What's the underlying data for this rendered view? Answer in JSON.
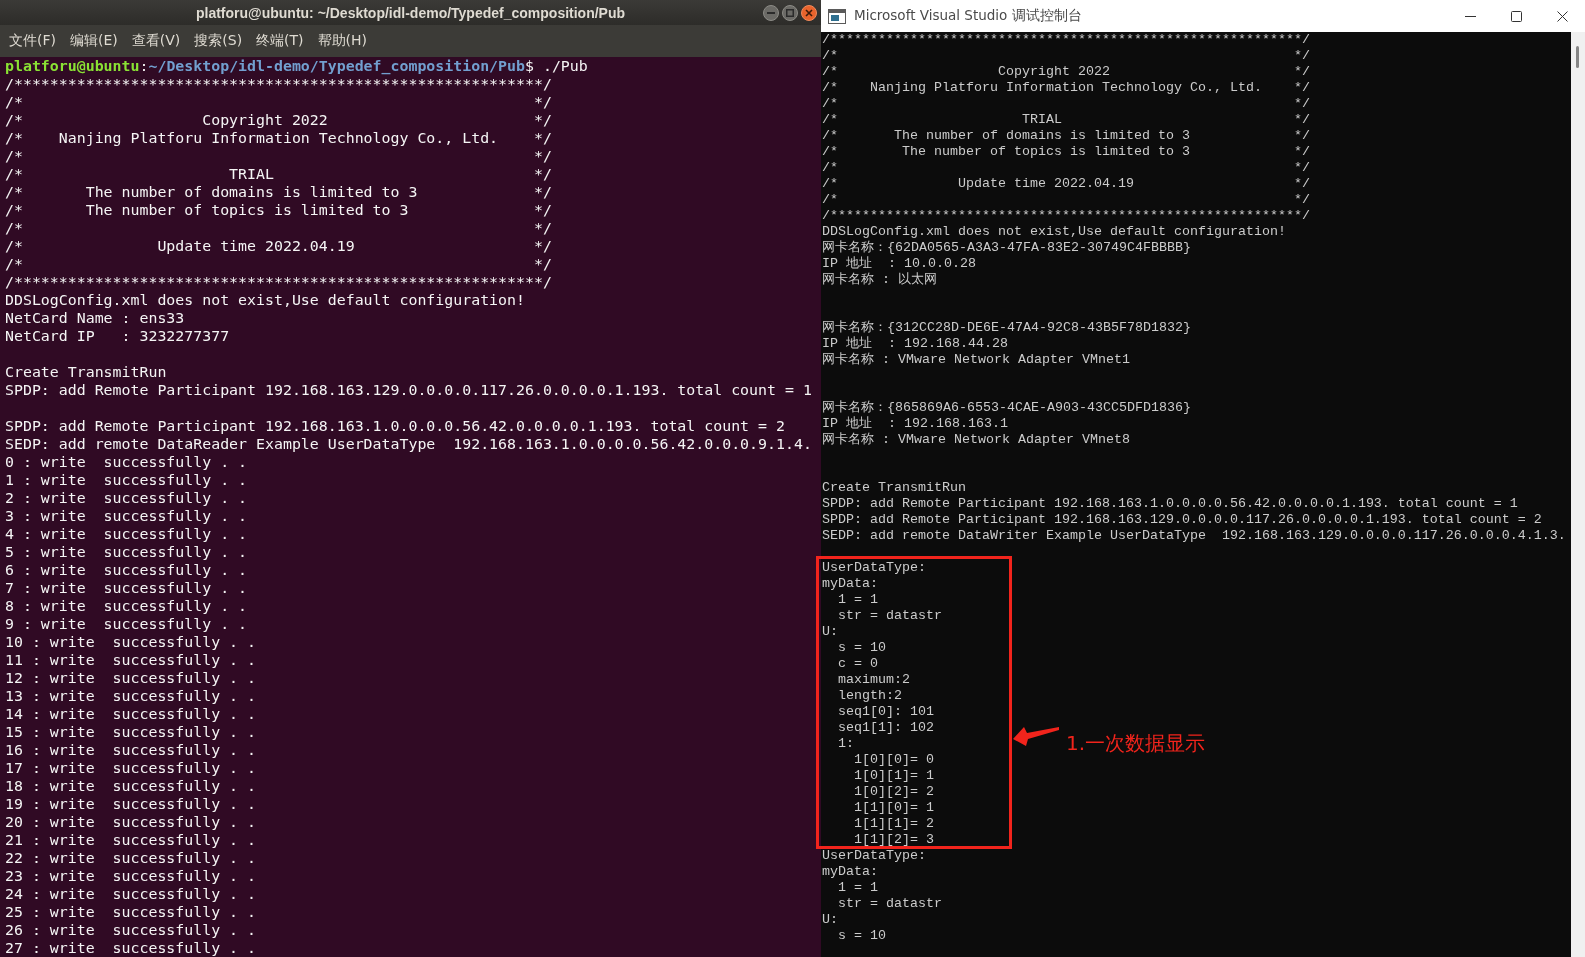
{
  "terminal_window": {
    "title": "platforu@ubuntu: ~/Desktop/idl-demo/Typedef_composition/Pub",
    "menu": [
      "文件(F)",
      "编辑(E)",
      "查看(V)",
      "搜索(S)",
      "终端(T)",
      "帮助(H)"
    ],
    "prompt": {
      "user_host": "platforu@ubuntu",
      "separator": ":",
      "path": "~/Desktop/idl-demo/Typedef_composition/Pub",
      "command": "$ ./Pub"
    },
    "lines": [
      {
        "kind": "text",
        "text": "/***********************************************************/"
      },
      {
        "kind": "text",
        "text": "/*                                                         */"
      },
      {
        "kind": "text",
        "text": "/*                    Copyright 2022                       */"
      },
      {
        "kind": "text",
        "text": "/*    Nanjing Platforu Information Technology Co., Ltd.    */"
      },
      {
        "kind": "text",
        "text": "/*                                                         */"
      },
      {
        "kind": "text",
        "text": "/*                       TRIAL                             */"
      },
      {
        "kind": "text",
        "text": "/*       The number of domains is limited to 3             */"
      },
      {
        "kind": "text",
        "text": "/*       The number of topics is limited to 3              */"
      },
      {
        "kind": "text",
        "text": "/*                                                         */"
      },
      {
        "kind": "text",
        "text": "/*               Update time 2022.04.19                    */"
      },
      {
        "kind": "text",
        "text": "/*                                                         */"
      },
      {
        "kind": "text",
        "text": "/***********************************************************/"
      },
      {
        "kind": "text",
        "text": "DDSLogConfig.xml does not exist,Use default configuration!"
      },
      {
        "kind": "text",
        "text": "NetCard Name : ens33"
      },
      {
        "kind": "text",
        "text": "NetCard IP   : 3232277377"
      },
      {
        "kind": "blank"
      },
      {
        "kind": "text",
        "text": "Create TransmitRun"
      },
      {
        "kind": "text",
        "text": "SPDP: add Remote Participant 192.168.163.129.0.0.0.0.117.26.0.0.0.0.1.193. total count = 1"
      },
      {
        "kind": "blank"
      },
      {
        "kind": "text",
        "text": "SPDP: add Remote Participant 192.168.163.1.0.0.0.0.56.42.0.0.0.0.1.193. total count = 2"
      },
      {
        "kind": "text",
        "text": "SEDP: add remote DataReader Example UserDataType  192.168.163.1.0.0.0.0.56.42.0.0.0.9.1.4."
      },
      {
        "kind": "text",
        "text": "0 : write  successfully . ."
      },
      {
        "kind": "text",
        "text": "1 : write  successfully . ."
      },
      {
        "kind": "text",
        "text": "2 : write  successfully . ."
      },
      {
        "kind": "text",
        "text": "3 : write  successfully . ."
      },
      {
        "kind": "text",
        "text": "4 : write  successfully . ."
      },
      {
        "kind": "text",
        "text": "5 : write  successfully . ."
      },
      {
        "kind": "text",
        "text": "6 : write  successfully . ."
      },
      {
        "kind": "text",
        "text": "7 : write  successfully . ."
      },
      {
        "kind": "text",
        "text": "8 : write  successfully . ."
      },
      {
        "kind": "text",
        "text": "9 : write  successfully . ."
      },
      {
        "kind": "text",
        "text": "10 : write  successfully . ."
      },
      {
        "kind": "text",
        "text": "11 : write  successfully . ."
      },
      {
        "kind": "text",
        "text": "12 : write  successfully . ."
      },
      {
        "kind": "text",
        "text": "13 : write  successfully . ."
      },
      {
        "kind": "text",
        "text": "14 : write  successfully . ."
      },
      {
        "kind": "text",
        "text": "15 : write  successfully . ."
      },
      {
        "kind": "text",
        "text": "16 : write  successfully . ."
      },
      {
        "kind": "text",
        "text": "17 : write  successfully . ."
      },
      {
        "kind": "text",
        "text": "18 : write  successfully . ."
      },
      {
        "kind": "text",
        "text": "19 : write  successfully . ."
      },
      {
        "kind": "text",
        "text": "20 : write  successfully . ."
      },
      {
        "kind": "text",
        "text": "21 : write  successfully . ."
      },
      {
        "kind": "text",
        "text": "22 : write  successfully . ."
      },
      {
        "kind": "text",
        "text": "23 : write  successfully . ."
      },
      {
        "kind": "text",
        "text": "24 : write  successfully . ."
      },
      {
        "kind": "text",
        "text": "25 : write  successfully . ."
      },
      {
        "kind": "text",
        "text": "26 : write  successfully . ."
      },
      {
        "kind": "text",
        "text": "27 : write  successfully . ."
      }
    ]
  },
  "console_window": {
    "title": "Microsoft Visual Studio 调试控制台",
    "lines": [
      {
        "kind": "text",
        "text": "/***********************************************************/"
      },
      {
        "kind": "text",
        "text": "/*                                                         */"
      },
      {
        "kind": "text",
        "text": "/*                    Copyright 2022                       */"
      },
      {
        "kind": "text",
        "text": "/*    Nanjing Platforu Information Technology Co., Ltd.    */"
      },
      {
        "kind": "text",
        "text": "/*                                                         */"
      },
      {
        "kind": "text",
        "text": "/*                       TRIAL                             */"
      },
      {
        "kind": "text",
        "text": "/*       The number of domains is limited to 3             */"
      },
      {
        "kind": "text",
        "text": "/*        The number of topics is limited to 3             */"
      },
      {
        "kind": "text",
        "text": "/*                                                         */"
      },
      {
        "kind": "text",
        "text": "/*               Update time 2022.04.19                    */"
      },
      {
        "kind": "text",
        "text": "/*                                                         */"
      },
      {
        "kind": "text",
        "text": "/***********************************************************/"
      },
      {
        "kind": "text",
        "text": "DDSLogConfig.xml does not exist,Use default configuration!"
      },
      {
        "kind": "text",
        "text": "网卡名称：{62DA0565-A3A3-47FA-83E2-30749C4FBBBB}"
      },
      {
        "kind": "text",
        "text": "IP 地址  : 10.0.0.28"
      },
      {
        "kind": "text",
        "text": "网卡名称 : 以太网"
      },
      {
        "kind": "blank"
      },
      {
        "kind": "blank"
      },
      {
        "kind": "text",
        "text": "网卡名称：{312CC28D-DE6E-47A4-92C8-43B5F78D1832}"
      },
      {
        "kind": "text",
        "text": "IP 地址  : 192.168.44.28"
      },
      {
        "kind": "text",
        "text": "网卡名称 : VMware Network Adapter VMnet1"
      },
      {
        "kind": "blank"
      },
      {
        "kind": "blank"
      },
      {
        "kind": "text",
        "text": "网卡名称：{865869A6-6553-4CAE-A903-43CC5DFD1836}"
      },
      {
        "kind": "text",
        "text": "IP 地址  : 192.168.163.1"
      },
      {
        "kind": "text",
        "text": "网卡名称 : VMware Network Adapter VMnet8"
      },
      {
        "kind": "blank"
      },
      {
        "kind": "blank"
      },
      {
        "kind": "text",
        "text": "Create TransmitRun"
      },
      {
        "kind": "text",
        "text": "SPDP: add Remote Participant 192.168.163.1.0.0.0.0.56.42.0.0.0.0.1.193. total count = 1"
      },
      {
        "kind": "text",
        "text": "SPDP: add Remote Participant 192.168.163.129.0.0.0.0.117.26.0.0.0.0.1.193. total count = 2"
      },
      {
        "kind": "text",
        "text": "SEDP: add remote DataWriter Example UserDataType  192.168.163.129.0.0.0.0.117.26.0.0.0.4.1.3."
      },
      {
        "kind": "blank"
      },
      {
        "kind": "text",
        "text": "UserDataType:"
      },
      {
        "kind": "text",
        "text": "myData:",
        "children": [
          {
            "kind": "text",
            "text": "1 = 1"
          },
          {
            "kind": "text",
            "text": "str = datastr"
          }
        ]
      },
      {
        "kind": "text",
        "text": "U:",
        "children": [
          {
            "kind": "text",
            "text": "s = 10"
          },
          {
            "kind": "text",
            "text": "c = 0"
          },
          {
            "kind": "text",
            "text": "maximum:2"
          },
          {
            "kind": "text",
            "text": "length:2"
          },
          {
            "kind": "text",
            "text": "seq1[0]: 101"
          },
          {
            "kind": "text",
            "text": "seq1[1]: 102"
          },
          {
            "kind": "text",
            "text": "1:",
            "children": [
              {
                "kind": "text",
                "text": "1[0][0]= 0"
              },
              {
                "kind": "text",
                "text": "1[0][1]= 1"
              },
              {
                "kind": "text",
                "text": "1[0][2]= 2"
              },
              {
                "kind": "text",
                "text": "1[1][0]= 1"
              },
              {
                "kind": "text",
                "text": "1[1][1]= 2"
              },
              {
                "kind": "text",
                "text": "1[1][2]= 3"
              }
            ]
          }
        ]
      },
      {
        "kind": "text",
        "text": "UserDataType:"
      },
      {
        "kind": "text",
        "text": "myData:",
        "children": [
          {
            "kind": "text",
            "text": "1 = 1"
          },
          {
            "kind": "text",
            "text": "str = datastr"
          }
        ]
      },
      {
        "kind": "text",
        "text": "U:",
        "children": [
          {
            "kind": "text",
            "text": "s = 10"
          }
        ]
      }
    ]
  },
  "annotation": {
    "label": "1.一次数据显示"
  }
}
